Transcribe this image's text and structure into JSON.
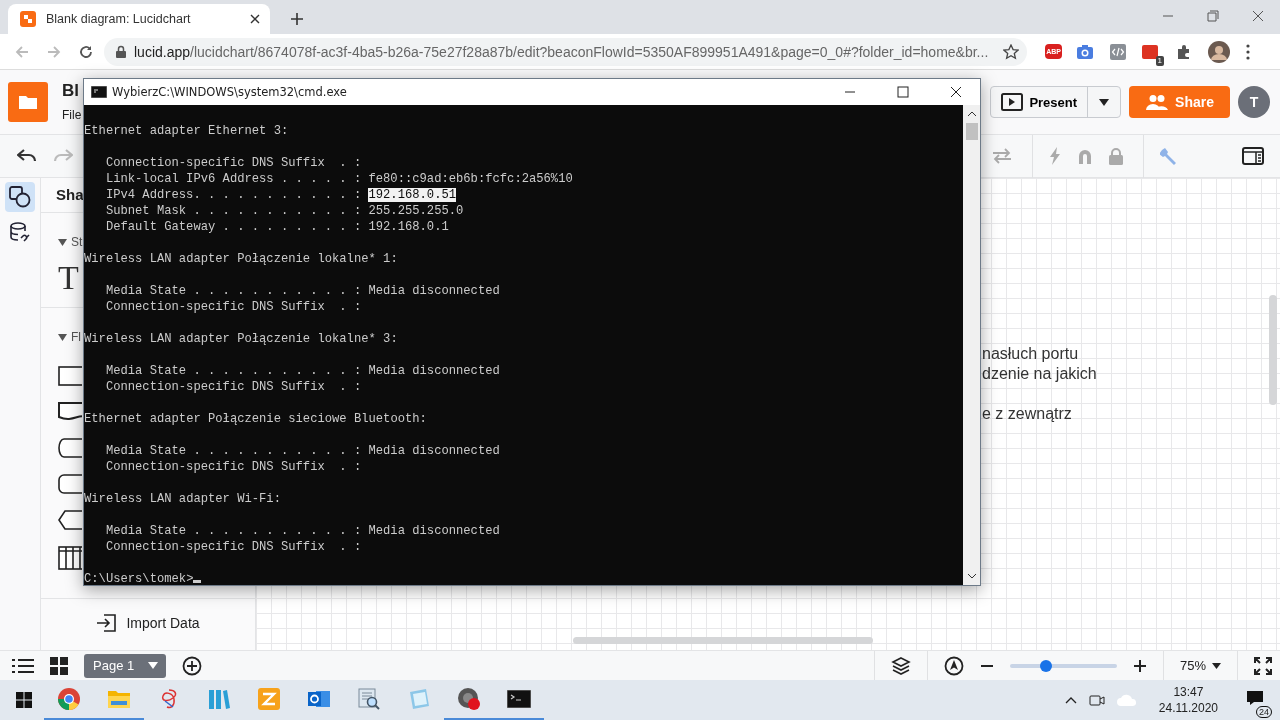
{
  "browser": {
    "tab": {
      "title": "Blank diagram: Lucidchart"
    },
    "url": {
      "host": "lucid.app",
      "path": "/lucidchart/8674078f-ac3f-4ba5-b26a-75e27f28a87b/edit?beaconFlowId=5350AF899951A491&page=0_0#?folder_id=home&br..."
    },
    "abp_label": "ABP",
    "extension_badge": "1"
  },
  "app": {
    "doc_title": "Bl",
    "menu": [
      "File"
    ],
    "present": "Present",
    "share": "Share",
    "avatar": "T"
  },
  "rail": [
    {
      "kind": "shapes",
      "selected": true
    },
    {
      "kind": "data",
      "selected": false
    }
  ],
  "sidebar": {
    "panel_title": "Sha",
    "sections": [
      {
        "title": "St",
        "expanded": true
      },
      {
        "title": "Fl",
        "expanded": true
      }
    ],
    "text_shape": "T",
    "import": "Import Data"
  },
  "canvas": {
    "paragraphs": [
      [
        "nasłuch portu",
        "dzenie na jakich"
      ],
      [
        "e z zewnątrz"
      ]
    ]
  },
  "footer": {
    "page": {
      "label": "Page 1",
      "selected": true
    },
    "zoom": {
      "level": 0.34,
      "label": "75%"
    }
  },
  "cmd": {
    "title": "WybierzC:\\WINDOWS\\system32\\cmd.exe",
    "sections": [
      {
        "heading": "Ethernet adapter Ethernet 3:",
        "entries": [
          {
            "label": "Connection-specific DNS Suffix  . :"
          },
          {
            "label": "Link-local IPv6 Address . . . . . :",
            "value": "fe80::c9ad:eb6b:fcfc:2a56%10",
            "selected": false
          },
          {
            "label": "IPv4 Address. . . . . . . . . . . :",
            "value": "192.168.0.51",
            "selected": true
          },
          {
            "label": "Subnet Mask . . . . . . . . . . . :",
            "value": "255.255.255.0",
            "selected": false
          },
          {
            "label": "Default Gateway . . . . . . . . . :",
            "value": "192.168.0.1",
            "selected": false
          }
        ]
      },
      {
        "heading": "Wireless LAN adapter Połączenie lokalne* 1:",
        "entries": [
          {
            "label": "Media State . . . . . . . . . . . :",
            "value": "Media disconnected",
            "selected": false
          },
          {
            "label": "Connection-specific DNS Suffix  . :"
          }
        ]
      },
      {
        "heading": "Wireless LAN adapter Połączenie lokalne* 3:",
        "entries": [
          {
            "label": "Media State . . . . . . . . . . . :",
            "value": "Media disconnected",
            "selected": false
          },
          {
            "label": "Connection-specific DNS Suffix  . :"
          }
        ]
      },
      {
        "heading": "Ethernet adapter Połączenie sieciowe Bluetooth:",
        "entries": [
          {
            "label": "Media State . . . . . . . . . . . :",
            "value": "Media disconnected",
            "selected": false
          },
          {
            "label": "Connection-specific DNS Suffix  . :"
          }
        ]
      },
      {
        "heading": "Wireless LAN adapter Wi-Fi:",
        "entries": [
          {
            "label": "Media State . . . . . . . . . . . :",
            "value": "Media disconnected",
            "selected": false
          },
          {
            "label": "Connection-specific DNS Suffix  . :"
          }
        ]
      }
    ],
    "prompt": "C:\\Users\\tomek>"
  },
  "taskbar": {
    "apps": [
      {
        "kind": "browser",
        "running": true
      },
      {
        "kind": "folder",
        "running": true
      },
      {
        "kind": "scribble",
        "running": false
      },
      {
        "kind": "books",
        "running": false
      },
      {
        "kind": "zapp",
        "running": false
      },
      {
        "kind": "mail",
        "running": false
      },
      {
        "kind": "search-doc",
        "running": false
      },
      {
        "kind": "notepad",
        "running": false
      },
      {
        "kind": "recorder",
        "running": true
      },
      {
        "kind": "terminal",
        "running": true
      }
    ],
    "time": "13:47",
    "date": "24.11.2020",
    "notifications": "24"
  }
}
